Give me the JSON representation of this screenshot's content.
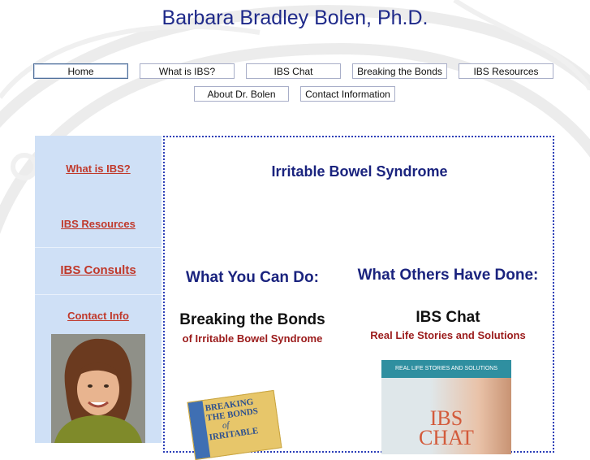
{
  "site": {
    "title": "Barbara Bradley Bolen, Ph.D."
  },
  "nav": {
    "row1": [
      "Home",
      "What is IBS?",
      "IBS Chat",
      "Breaking the Bonds",
      "IBS Resources"
    ],
    "row2": [
      "About Dr.  Bolen",
      "Contact Information"
    ],
    "active": "Home"
  },
  "sidebar": {
    "links": [
      "What is IBS? ",
      "IBS Resources",
      "IBS Consults",
      "Contact Info"
    ]
  },
  "main": {
    "title": "Irritable Bowel Syndrome",
    "left": {
      "heading": "What You Can Do:",
      "book_title": "Breaking the Bonds",
      "book_subtitle": "of Irritable Bowel Syndrome",
      "cover_text": [
        "BREAKING",
        "THE BONDS",
        "of",
        "IRRITABLE"
      ]
    },
    "right": {
      "heading": "What Others Have Done:",
      "book_title": "IBS Chat",
      "book_subtitle": "Real Life Stories and Solutions",
      "cover_banner": "REAL LIFE STORIES AND SOLUTIONS",
      "cover_big": [
        "IBS",
        "CHAT"
      ]
    }
  },
  "colors": {
    "title_blue": "#1f2a8a",
    "heading_navy": "#1a237e",
    "link_red": "#c0392b",
    "subtitle_red": "#9b1b1b",
    "sidebar_bg": "#cfe0f6",
    "content_border": "#2c3fb8"
  }
}
